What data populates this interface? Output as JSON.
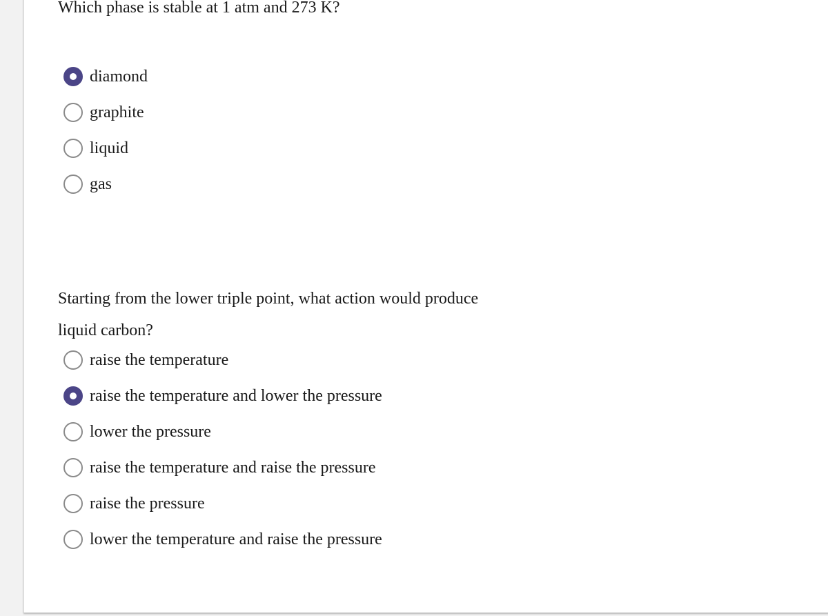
{
  "questions": [
    {
      "text": "Which phase is stable at 1 atm and 273 K?",
      "options": [
        {
          "label": "diamond",
          "selected": true
        },
        {
          "label": "graphite",
          "selected": false
        },
        {
          "label": "liquid",
          "selected": false
        },
        {
          "label": "gas",
          "selected": false
        }
      ]
    },
    {
      "text": "Starting from the lower triple point, what action would produce liquid carbon?",
      "options": [
        {
          "label": "raise the temperature",
          "selected": false
        },
        {
          "label": "raise the temperature and lower the pressure",
          "selected": true
        },
        {
          "label": "lower the pressure",
          "selected": false
        },
        {
          "label": "raise the temperature and raise the pressure",
          "selected": false
        },
        {
          "label": "raise the pressure",
          "selected": false
        },
        {
          "label": "lower the temperature and raise the pressure",
          "selected": false
        }
      ]
    }
  ],
  "colors": {
    "radio_selected": "#4b4587",
    "radio_unselected": "#8a8a8a"
  }
}
